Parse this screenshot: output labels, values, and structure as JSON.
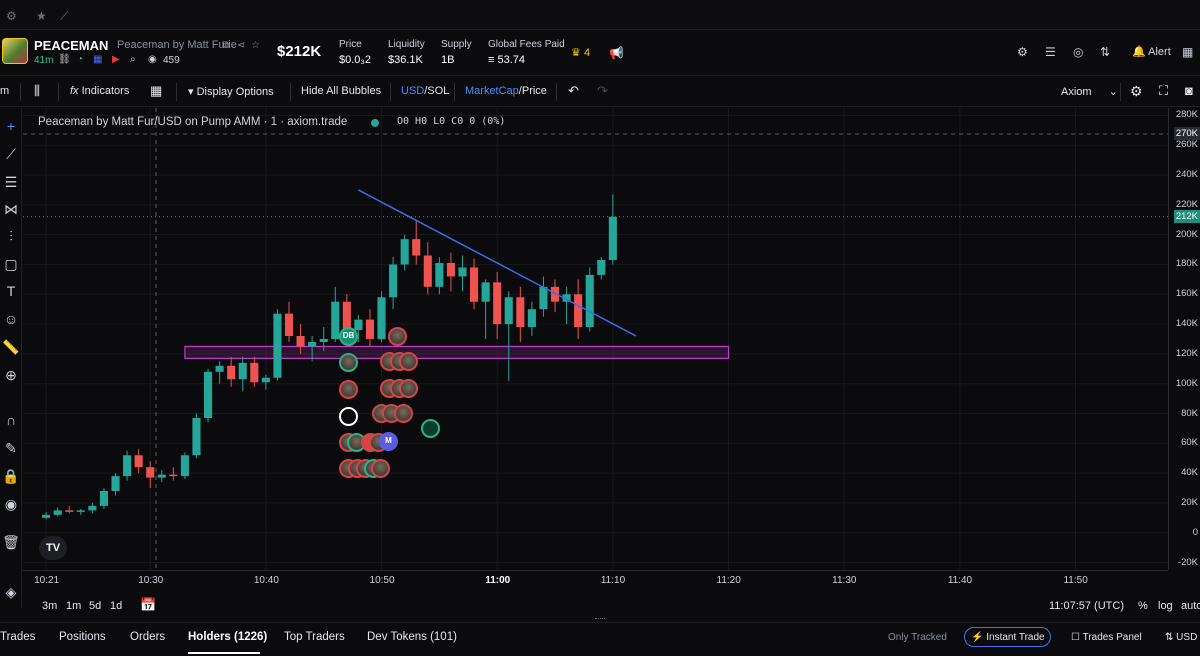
{
  "header": {
    "ticker": "PEACEMAN",
    "token_name": "Peaceman by Matt Furie",
    "age": "41m",
    "holders_count": "459",
    "market_cap": "$212K",
    "stats": [
      {
        "label": "Price",
        "value": "$0.0₃2"
      },
      {
        "label": "Liquidity",
        "value": "$36.1K"
      },
      {
        "label": "Supply",
        "value": "1B"
      },
      {
        "label": "Global Fees Paid",
        "value": "≡ 53.74"
      }
    ],
    "crown_count": "4",
    "alert_label": "Alert"
  },
  "toolbar": {
    "timeframe": "m",
    "indicators_label": "Indicators",
    "display_options_label": "Display Options",
    "hide_bubbles_label": "Hide All Bubbles",
    "usd_label": "USD",
    "sol_label": "/SOL",
    "marketcap_label": "MarketCap",
    "price_label": "/Price",
    "provider_label": "Axiom"
  },
  "legend": {
    "title": "Peaceman by Matt Fur/USD on Pump AMM · 1 · axiom.trade",
    "ohlc": "O0 H0 L0 C0 0 (0%)"
  },
  "y_ticks": [
    "280K",
    "260K",
    "240K",
    "220K",
    "200K",
    "180K",
    "160K",
    "140K",
    "120K",
    "100K",
    "80K",
    "60K",
    "40K",
    "20K",
    "0",
    "-20K"
  ],
  "y_badges": {
    "top": "270K",
    "current": "212K"
  },
  "x_ticks": [
    "10:21",
    "10:30",
    "10:40",
    "10:50",
    "11:00",
    "11:10",
    "11:20",
    "11:30",
    "11:40",
    "11:50"
  ],
  "bottom_bar": {
    "timeframes": [
      "3m",
      "1m",
      "5d",
      "1d"
    ],
    "clock": "11:07:57 (UTC)",
    "percent": "%",
    "log": "log",
    "auto": "auto"
  },
  "tabs": {
    "items": [
      "Trades",
      "Positions",
      "Orders",
      "Holders (1226)",
      "Top Traders",
      "Dev Tokens (101)"
    ],
    "active": "Holders (1226)",
    "only_tracked": "Only Tracked",
    "instant_trade": "Instant Trade",
    "trades_panel": "Trades Panel",
    "currency": "USD"
  },
  "bubbles_labels": {
    "db": "DB",
    "m": "M"
  },
  "colors": {
    "up": "#26a69a",
    "down": "#ef5350",
    "trendline": "#3b6cf0",
    "zone": "#c23ccf"
  },
  "chart_data": {
    "type": "candlestick",
    "x_range": [
      "10:19",
      "11:58"
    ],
    "y_range": [
      -25000,
      285000
    ],
    "current_value": 212000,
    "candles": [
      {
        "t": "10:21",
        "o": 10000,
        "h": 14000,
        "l": 9000,
        "c": 12000
      },
      {
        "t": "10:22",
        "o": 12000,
        "h": 17000,
        "l": 11000,
        "c": 15000
      },
      {
        "t": "10:23",
        "o": 15000,
        "h": 18000,
        "l": 13000,
        "c": 14000
      },
      {
        "t": "10:24",
        "o": 14000,
        "h": 16000,
        "l": 12000,
        "c": 15000
      },
      {
        "t": "10:25",
        "o": 15000,
        "h": 20000,
        "l": 13000,
        "c": 18000
      },
      {
        "t": "10:26",
        "o": 18000,
        "h": 30000,
        "l": 16000,
        "c": 28000
      },
      {
        "t": "10:27",
        "o": 28000,
        "h": 40000,
        "l": 25000,
        "c": 38000
      },
      {
        "t": "10:28",
        "o": 38000,
        "h": 55000,
        "l": 35000,
        "c": 52000
      },
      {
        "t": "10:29",
        "o": 52000,
        "h": 56000,
        "l": 40000,
        "c": 44000
      },
      {
        "t": "10:30",
        "o": 44000,
        "h": 48000,
        "l": 30000,
        "c": 37000
      },
      {
        "t": "10:31",
        "o": 37000,
        "h": 42000,
        "l": 34000,
        "c": 39000
      },
      {
        "t": "10:32",
        "o": 39000,
        "h": 44000,
        "l": 35000,
        "c": 38000
      },
      {
        "t": "10:33",
        "o": 38000,
        "h": 54000,
        "l": 36000,
        "c": 52000
      },
      {
        "t": "10:34",
        "o": 52000,
        "h": 80000,
        "l": 50000,
        "c": 77000
      },
      {
        "t": "10:35",
        "o": 77000,
        "h": 110000,
        "l": 74000,
        "c": 108000
      },
      {
        "t": "10:36",
        "o": 108000,
        "h": 115000,
        "l": 100000,
        "c": 112000
      },
      {
        "t": "10:37",
        "o": 112000,
        "h": 118000,
        "l": 98000,
        "c": 103000
      },
      {
        "t": "10:38",
        "o": 103000,
        "h": 118000,
        "l": 95000,
        "c": 114000
      },
      {
        "t": "10:39",
        "o": 114000,
        "h": 118000,
        "l": 98000,
        "c": 101000
      },
      {
        "t": "10:40",
        "o": 101000,
        "h": 106000,
        "l": 96000,
        "c": 104000
      },
      {
        "t": "10:41",
        "o": 104000,
        "h": 150000,
        "l": 102000,
        "c": 147000
      },
      {
        "t": "10:42",
        "o": 147000,
        "h": 155000,
        "l": 128000,
        "c": 132000
      },
      {
        "t": "10:43",
        "o": 132000,
        "h": 140000,
        "l": 120000,
        "c": 125000
      },
      {
        "t": "10:44",
        "o": 125000,
        "h": 132000,
        "l": 115000,
        "c": 128000
      },
      {
        "t": "10:45",
        "o": 128000,
        "h": 138000,
        "l": 122000,
        "c": 130000
      },
      {
        "t": "10:46",
        "o": 130000,
        "h": 165000,
        "l": 128000,
        "c": 155000
      },
      {
        "t": "10:47",
        "o": 155000,
        "h": 160000,
        "l": 130000,
        "c": 136000
      },
      {
        "t": "10:48",
        "o": 136000,
        "h": 146000,
        "l": 128000,
        "c": 143000
      },
      {
        "t": "10:49",
        "o": 143000,
        "h": 150000,
        "l": 125000,
        "c": 130000
      },
      {
        "t": "10:50",
        "o": 130000,
        "h": 162000,
        "l": 128000,
        "c": 158000
      },
      {
        "t": "10:51",
        "o": 158000,
        "h": 185000,
        "l": 150000,
        "c": 180000
      },
      {
        "t": "10:52",
        "o": 180000,
        "h": 200000,
        "l": 176000,
        "c": 197000
      },
      {
        "t": "10:53",
        "o": 197000,
        "h": 210000,
        "l": 180000,
        "c": 186000
      },
      {
        "t": "10:54",
        "o": 186000,
        "h": 195000,
        "l": 160000,
        "c": 165000
      },
      {
        "t": "10:55",
        "o": 165000,
        "h": 185000,
        "l": 160000,
        "c": 181000
      },
      {
        "t": "10:56",
        "o": 181000,
        "h": 188000,
        "l": 162000,
        "c": 172000
      },
      {
        "t": "10:57",
        "o": 172000,
        "h": 186000,
        "l": 162000,
        "c": 178000
      },
      {
        "t": "10:58",
        "o": 178000,
        "h": 184000,
        "l": 150000,
        "c": 155000
      },
      {
        "t": "10:59",
        "o": 155000,
        "h": 170000,
        "l": 130000,
        "c": 168000
      },
      {
        "t": "11:00",
        "o": 168000,
        "h": 175000,
        "l": 130000,
        "c": 140000
      },
      {
        "t": "11:01",
        "o": 140000,
        "h": 162000,
        "l": 102000,
        "c": 158000
      },
      {
        "t": "11:02",
        "o": 158000,
        "h": 165000,
        "l": 128000,
        "c": 138000
      },
      {
        "t": "11:03",
        "o": 138000,
        "h": 155000,
        "l": 132000,
        "c": 150000
      },
      {
        "t": "11:04",
        "o": 150000,
        "h": 172000,
        "l": 145000,
        "c": 165000
      },
      {
        "t": "11:05",
        "o": 165000,
        "h": 170000,
        "l": 148000,
        "c": 155000
      },
      {
        "t": "11:06",
        "o": 155000,
        "h": 165000,
        "l": 140000,
        "c": 160000
      },
      {
        "t": "11:07",
        "o": 160000,
        "h": 170000,
        "l": 130000,
        "c": 138000
      },
      {
        "t": "11:08",
        "o": 138000,
        "h": 178000,
        "l": 135000,
        "c": 173000
      },
      {
        "t": "11:09",
        "o": 173000,
        "h": 185000,
        "l": 170000,
        "c": 183000
      },
      {
        "t": "11:10",
        "o": 183000,
        "h": 227000,
        "l": 180000,
        "c": 212000
      }
    ],
    "trendline": [
      {
        "t": "10:48",
        "v": 230000
      },
      {
        "t": "11:12",
        "v": 132000
      }
    ],
    "zone": {
      "t_start": "10:33",
      "t_end": "11:20",
      "v_low": 117000,
      "v_high": 125000
    }
  }
}
